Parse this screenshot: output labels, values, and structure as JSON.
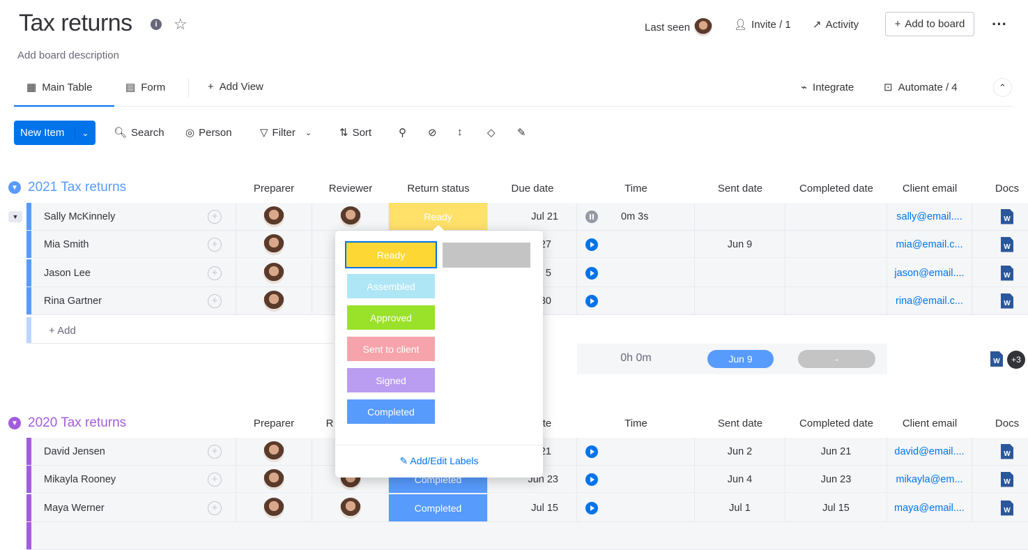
{
  "header": {
    "title": "Tax returns",
    "description": "Add board description",
    "last_seen": "Last seen",
    "invite": "Invite / 1",
    "activity": "Activity",
    "add_to_board": "Add to board"
  },
  "views": {
    "main_table": "Main Table",
    "form": "Form",
    "add_view": "Add View",
    "integrate": "Integrate",
    "automate": "Automate / 4"
  },
  "toolbar": {
    "new_item": "New Item",
    "search": "Search",
    "person": "Person",
    "filter": "Filter",
    "sort": "Sort"
  },
  "columns": {
    "preparer": "Preparer",
    "reviewer": "Reviewer",
    "status": "Return status",
    "due": "Due date",
    "time": "Time",
    "sent": "Sent date",
    "completed": "Completed date",
    "email": "Client email",
    "docs": "Docs"
  },
  "groups": [
    {
      "title": "2021 Tax returns",
      "color": "#579bfc",
      "add": "+ Add",
      "rows": [
        {
          "name": "Sally McKinnely",
          "status": "Ready",
          "status_color": "#ffe16a",
          "due": "Jul 21",
          "time": "0m 3s",
          "timer": "paused",
          "sent": "",
          "completed": "",
          "email": "sally@email...."
        },
        {
          "name": "Mia Smith",
          "due": "27",
          "sent": "Jun 9",
          "email": "mia@email.c..."
        },
        {
          "name": "Jason Lee",
          "due": "5",
          "sent": "",
          "email": "jason@email...."
        },
        {
          "name": "Rina Gartner",
          "due": "30",
          "sent": "",
          "email": "rina@email.c..."
        }
      ],
      "summary": {
        "time": "0h 0m",
        "sent": "Jun 9",
        "completed": "-",
        "docs_more": "+3"
      }
    },
    {
      "title": "2020 Tax returns",
      "color": "#a25ddc",
      "reviewer_partial": "R",
      "due_partial": "te",
      "rows": [
        {
          "name": "David Jensen",
          "due": "21",
          "sent": "Jun 2",
          "completed": "Jun 21",
          "email": "david@email...."
        },
        {
          "name": "Mikayla Rooney",
          "status": "Completed",
          "due": "Jun 23",
          "sent": "Jun 4",
          "completed": "Jun 23",
          "email": "mikayla@em..."
        },
        {
          "name": "Maya Werner",
          "status": "Completed",
          "due": "Jul 15",
          "sent": "Jul 1",
          "completed": "Jul 15",
          "email": "maya@email...."
        }
      ]
    }
  ],
  "status_menu": {
    "labels": [
      {
        "text": "Ready",
        "color": "#fdd835"
      },
      {
        "text": "Assembled",
        "color": "#aee6f5"
      },
      {
        "text": "Approved",
        "color": "#9ae12a"
      },
      {
        "text": "Sent to client",
        "color": "#f7a3ab"
      },
      {
        "text": "Signed",
        "color": "#ba9cf0"
      },
      {
        "text": "Completed",
        "color": "#579bfc"
      }
    ],
    "edit": "Add/Edit Labels"
  },
  "doc_letter": "W"
}
